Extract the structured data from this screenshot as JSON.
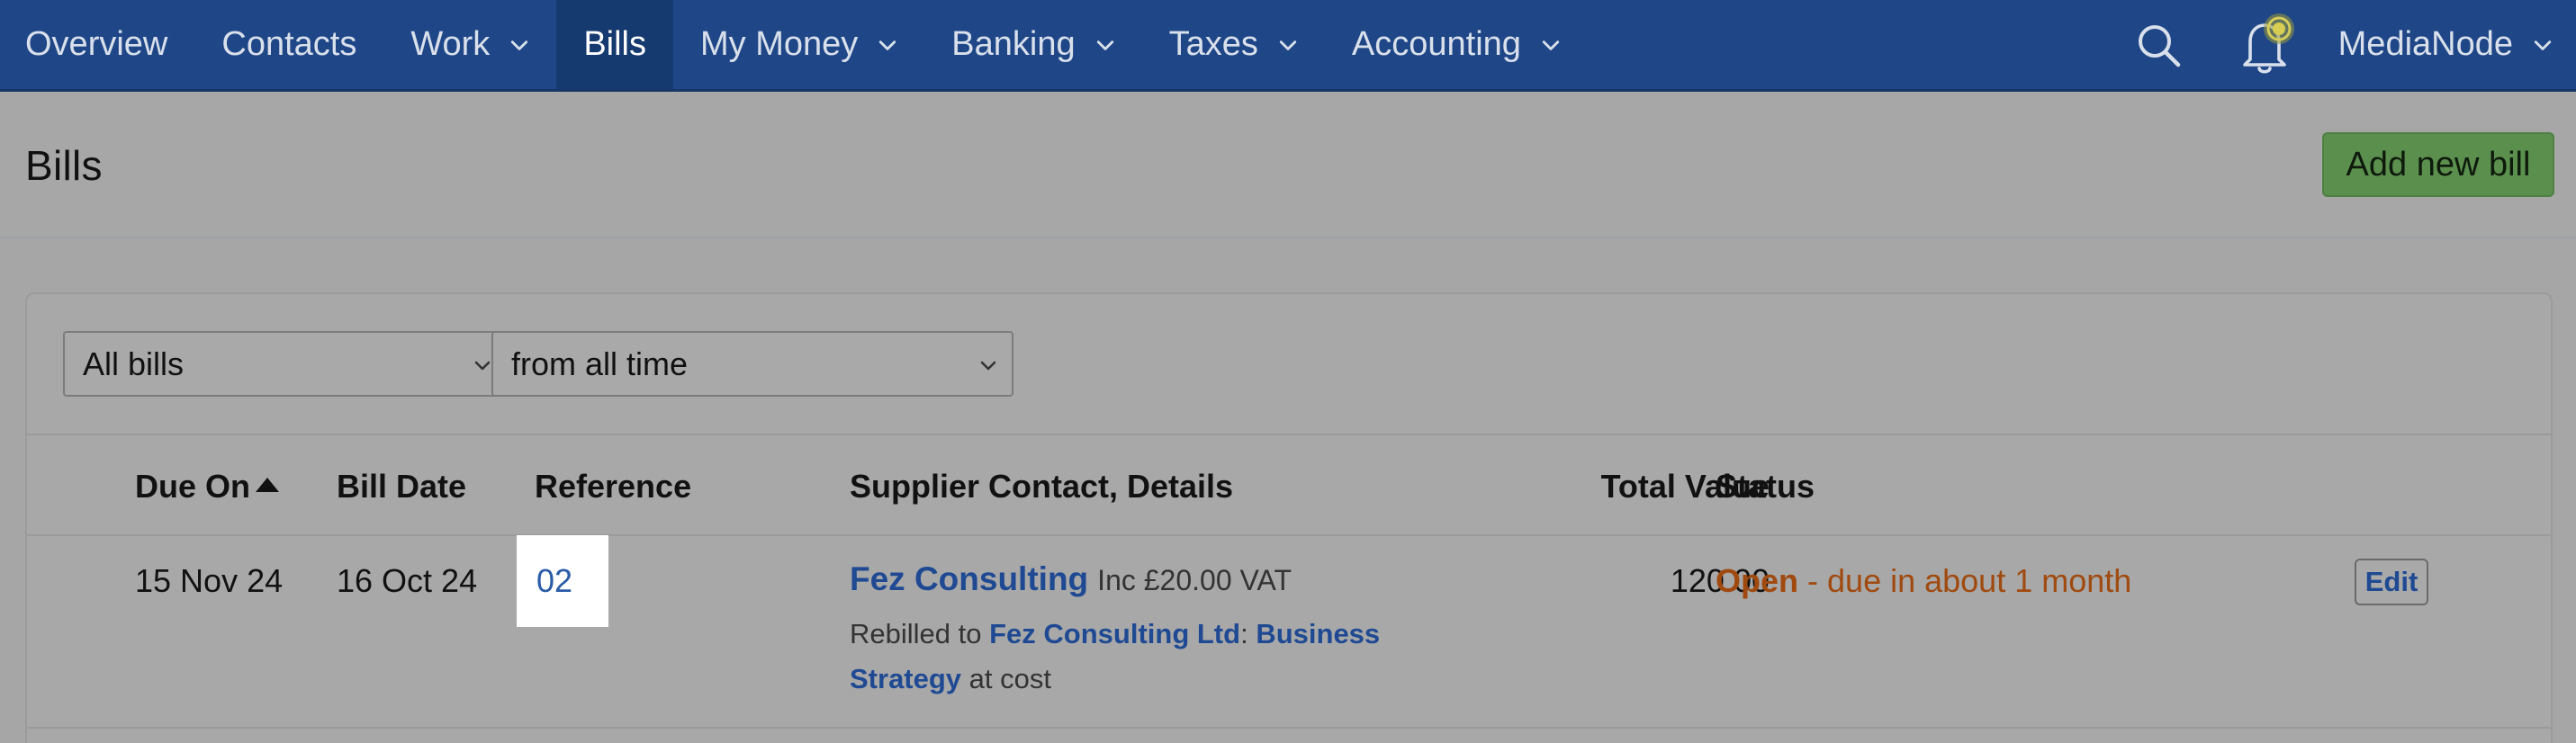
{
  "nav": {
    "items": [
      {
        "label": "Overview",
        "dropdown": false,
        "active": false
      },
      {
        "label": "Contacts",
        "dropdown": false,
        "active": false
      },
      {
        "label": "Work",
        "dropdown": true,
        "active": false
      },
      {
        "label": "Bills",
        "dropdown": false,
        "active": true
      },
      {
        "label": "My Money",
        "dropdown": true,
        "active": false
      },
      {
        "label": "Banking",
        "dropdown": true,
        "active": false
      },
      {
        "label": "Taxes",
        "dropdown": true,
        "active": false
      },
      {
        "label": "Accounting",
        "dropdown": true,
        "active": false
      }
    ],
    "search_icon": "search-icon",
    "notifications_icon": "bell-icon",
    "account_name": "MediaNode"
  },
  "header": {
    "title": "Bills",
    "add_button": "Add new bill"
  },
  "filters": {
    "type_selected": "All bills",
    "period_selected": "from all time"
  },
  "table": {
    "headers": {
      "due_on": "Due On",
      "bill_date": "Bill Date",
      "reference": "Reference",
      "supplier": "Supplier Contact, Details",
      "total_value": "Total Value",
      "status": "Status"
    },
    "sort": {
      "column": "Due On",
      "direction": "ascending"
    },
    "rows": [
      {
        "due_on": "15 Nov 24",
        "bill_date": "16 Oct 24",
        "reference": "02",
        "supplier_name": "Fez Consulting",
        "vat_note": "Inc £20.00 VAT",
        "rebilled_prefix": "Rebilled to",
        "rebilled_contact": "Fez Consulting Ltd",
        "rebilled_separator": ":",
        "rebilled_project": "Business Strategy",
        "rebilled_suffix": "at cost",
        "total_value": "120.00",
        "status_label": "Open",
        "status_detail": "- due in about 1 month",
        "edit_label": "Edit"
      }
    ]
  },
  "colors": {
    "nav_bg": "#1f4788",
    "nav_active": "#153a70",
    "add_button": "#5b8f4e",
    "link": "#1f4a93",
    "status_open": "#a04a10"
  }
}
